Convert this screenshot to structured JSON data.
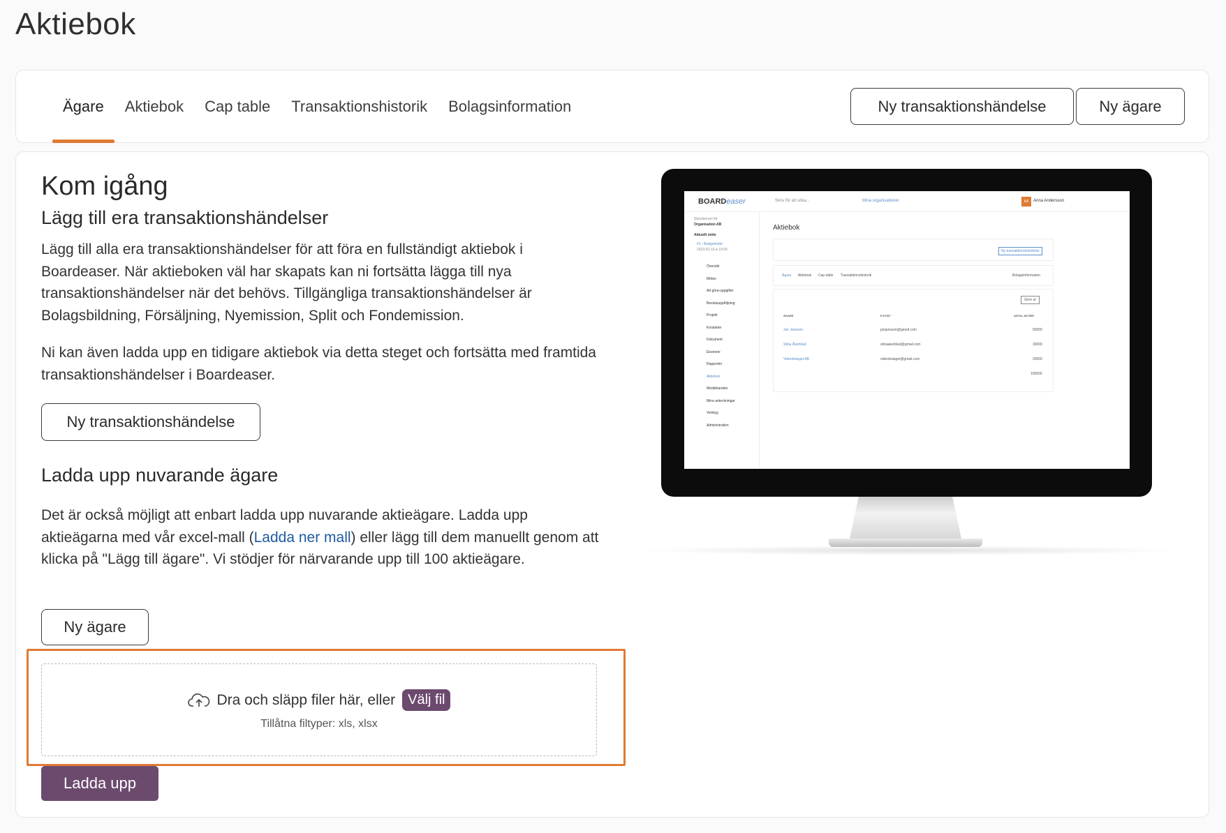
{
  "page": {
    "title": "Aktiebok"
  },
  "tabs": [
    {
      "label": "Ägare",
      "active": true
    },
    {
      "label": "Aktiebok",
      "active": false
    },
    {
      "label": "Cap table",
      "active": false
    },
    {
      "label": "Transaktionshistorik",
      "active": false
    },
    {
      "label": "Bolagsinformation",
      "active": false
    }
  ],
  "header_actions": {
    "new_transaction": "Ny transaktionshändelse",
    "new_owner": "Ny ägare"
  },
  "intro": {
    "title": "Kom igång",
    "transactions_heading": "Lägg till era transaktionshändelser",
    "transactions_text": "Lägg till alla era transaktionshändelser för att föra en fullständigt aktiebok i Boardeaser. När aktieboken väl har skapats kan ni fortsätta lägga till nya transaktionshändelser när det behövs. Tillgängliga transaktionshändelser är Bolagsbildning, Försäljning, Nyemission, Split och Fondemission.",
    "upload_previous_text": "Ni kan även ladda upp en tidigare aktiebok via detta steget och fortsätta med framtida transaktionshändelser i Boardeaser.",
    "new_transaction_button": "Ny transaktionshändelse",
    "owners_heading": "Ladda upp nuvarande ägare",
    "owners_text_before": "Det är också möjligt att enbart ladda upp nuvarande aktieägare. Ladda upp aktieägarna med vår excel-mall (",
    "download_template_link": "Ladda ner mall",
    "owners_text_after": ") eller lägg till dem manuellt genom att klicka på \"Lägg till ägare\". Vi stödjer för närvarande upp till 100 aktieägare.",
    "new_owner_button": "Ny ägare"
  },
  "dropzone": {
    "text": "Dra och släpp filer här, eller",
    "choose_file": "Välj fil",
    "allowed_types": "Tillåtna filtyper: xls, xlsx",
    "icon": "cloud-upload-icon"
  },
  "upload_button": "Ladda upp",
  "accent_colors": {
    "orange": "#e07b34",
    "purple": "#6c4a6e",
    "link": "#1e5aa0"
  },
  "monitor_preview": {
    "logo_bold": "BOARD",
    "logo_light": "easer",
    "search": "Skriv för att söka...",
    "orgs": "Mina organisationer",
    "user": "Anna Andersson",
    "avatar": "AA",
    "org_label": "Styrelserum för",
    "org_name": "Organisation AB",
    "current_meeting": "Aktuellt möte",
    "meeting_name": "#1 - Budgetmöte",
    "meeting_date": "2023-01-10 ● 14:00",
    "nav": [
      "Översikt",
      "Möten",
      "Att göra-uppgifter",
      "Beslutsuppföljning",
      "Projekt",
      "Kontakter",
      "Dokument",
      "Ekonomi",
      "Rapporter",
      "Aktiebok",
      "Meddelanden",
      "Mina anteckningar",
      "Verktyg",
      "Administration"
    ],
    "title": "Aktiebok",
    "new_transaction": "Ny transaktionshändelse",
    "tabs": [
      "Ägare",
      "Aktiebok",
      "Cap table",
      "Transaktionshistorik"
    ],
    "company_info": "Bolagsinformation",
    "print": "Skriv ut",
    "columns": [
      "ÄGARE",
      "E-POST",
      "ANTAL AKTIER"
    ],
    "rows": [
      {
        "owner": "Jan Jansson",
        "email": "janjansson@gmail.com",
        "shares": "50000"
      },
      {
        "owner": "Stina Åkerblad",
        "email": "stinaakerblad@gmail.com",
        "shares": "30000"
      },
      {
        "owner": "Videobolaget AB",
        "email": "videobolaget@gmail.com",
        "shares": "20000"
      }
    ],
    "total": "100000"
  }
}
